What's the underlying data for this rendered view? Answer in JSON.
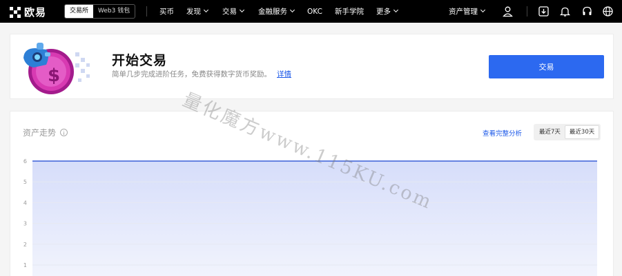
{
  "header": {
    "logo_text": "欧易",
    "mode_switch": [
      "交易所",
      "Web3 钱包"
    ],
    "nav_items": [
      {
        "label": "买币",
        "dropdown": false
      },
      {
        "label": "发现",
        "dropdown": true
      },
      {
        "label": "交易",
        "dropdown": true
      },
      {
        "label": "金融服务",
        "dropdown": true
      },
      {
        "label": "OKC",
        "dropdown": false
      },
      {
        "label": "新手学院",
        "dropdown": false
      },
      {
        "label": "更多",
        "dropdown": true
      }
    ],
    "asset_menu": "资产管理",
    "icons": [
      "user-icon",
      "download-icon",
      "bell-icon",
      "headset-icon",
      "globe-icon"
    ]
  },
  "start_card": {
    "title": "开始交易",
    "description": "简单几步完成进阶任务，免费获得数字货币奖励。",
    "link": "详情",
    "button": "交易"
  },
  "trend_card": {
    "title": "资产走势",
    "analysis_link": "查看完整分析",
    "ranges": [
      {
        "label": "最近7天",
        "active": false
      },
      {
        "label": "最近30天",
        "active": true
      }
    ]
  },
  "chart_data": {
    "type": "area",
    "y_ticks": [
      "6",
      "5",
      "4",
      "3",
      "2",
      "1"
    ],
    "ylim": [
      0,
      6
    ],
    "series": [
      {
        "values": [
          6,
          6
        ]
      }
    ],
    "grid": true,
    "line_color": "#3a5fd8",
    "fill_color": "#dfe5fb"
  },
  "watermark": "量化魔方www.115KU.com",
  "colors": {
    "accent": "#2c69f0",
    "link": "#1a57e8",
    "topbar": "#000000"
  }
}
